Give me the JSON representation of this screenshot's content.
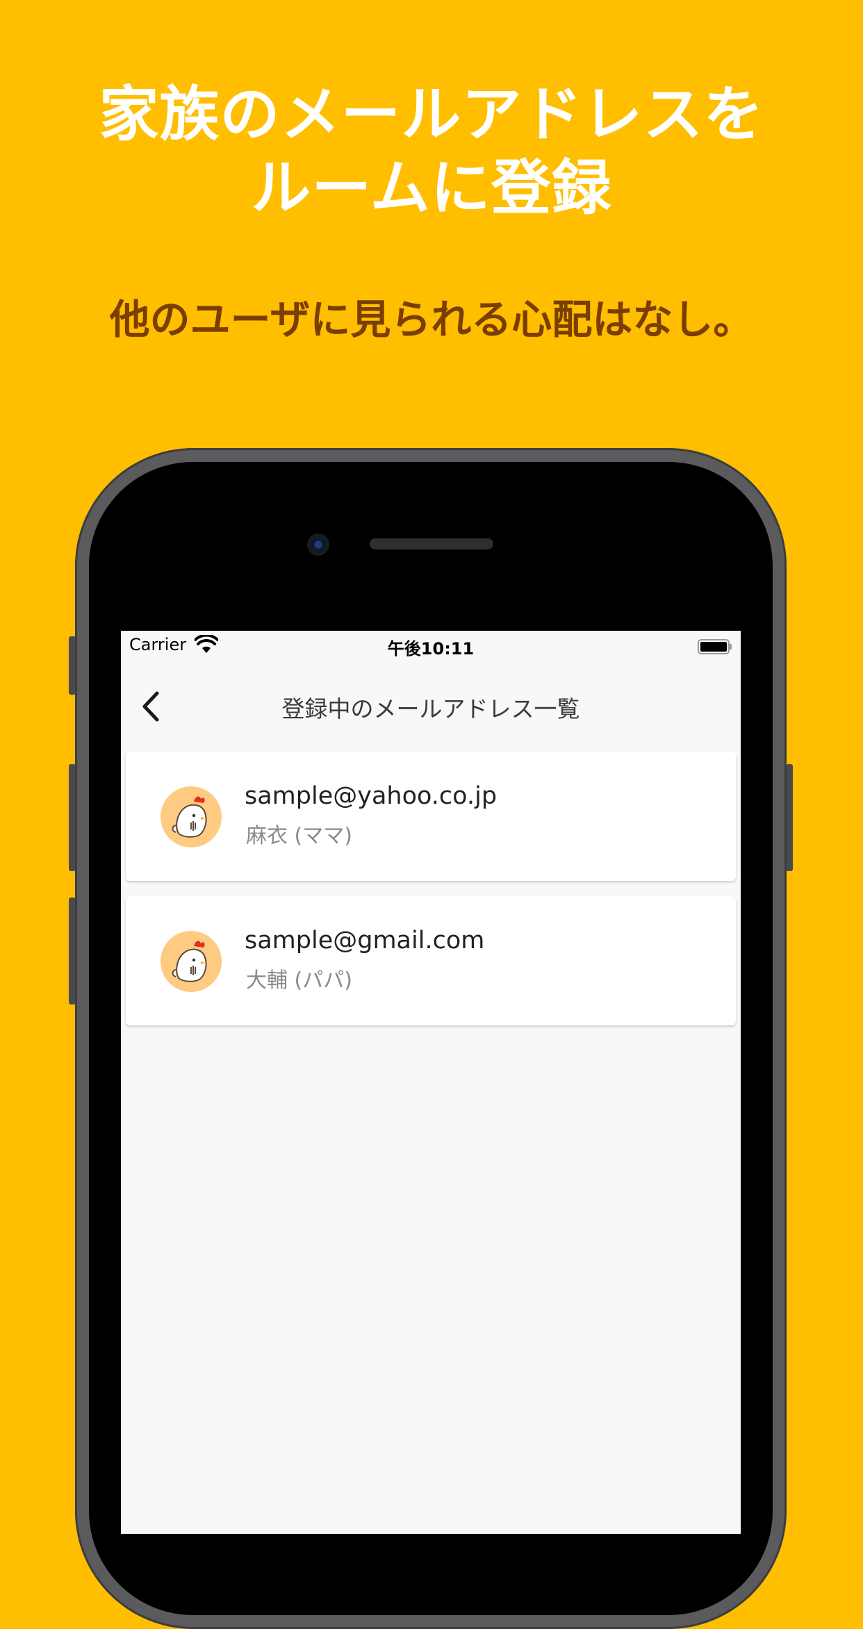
{
  "promo": {
    "headline_line1": "家族のメールアドレスを",
    "headline_line2": "ルームに登録",
    "subheadline": "他のユーザに見られる心配はなし。"
  },
  "statusbar": {
    "carrier": "Carrier",
    "time": "午後10:11"
  },
  "navbar": {
    "title": "登録中のメールアドレス一覧",
    "back_icon": "chevron-left-icon"
  },
  "contacts": [
    {
      "email": "sample@yahoo.co.jp",
      "name": "麻衣 (ママ)",
      "avatar_icon": "chicken-avatar-icon"
    },
    {
      "email": "sample@gmail.com",
      "name": "大輔 (パパ)",
      "avatar_icon": "chicken-avatar-icon"
    }
  ],
  "colors": {
    "background": "#FFBE00",
    "headline": "#FFFFFF",
    "subheadline": "#7A3E00",
    "avatar_bg": "#FFCB82"
  }
}
